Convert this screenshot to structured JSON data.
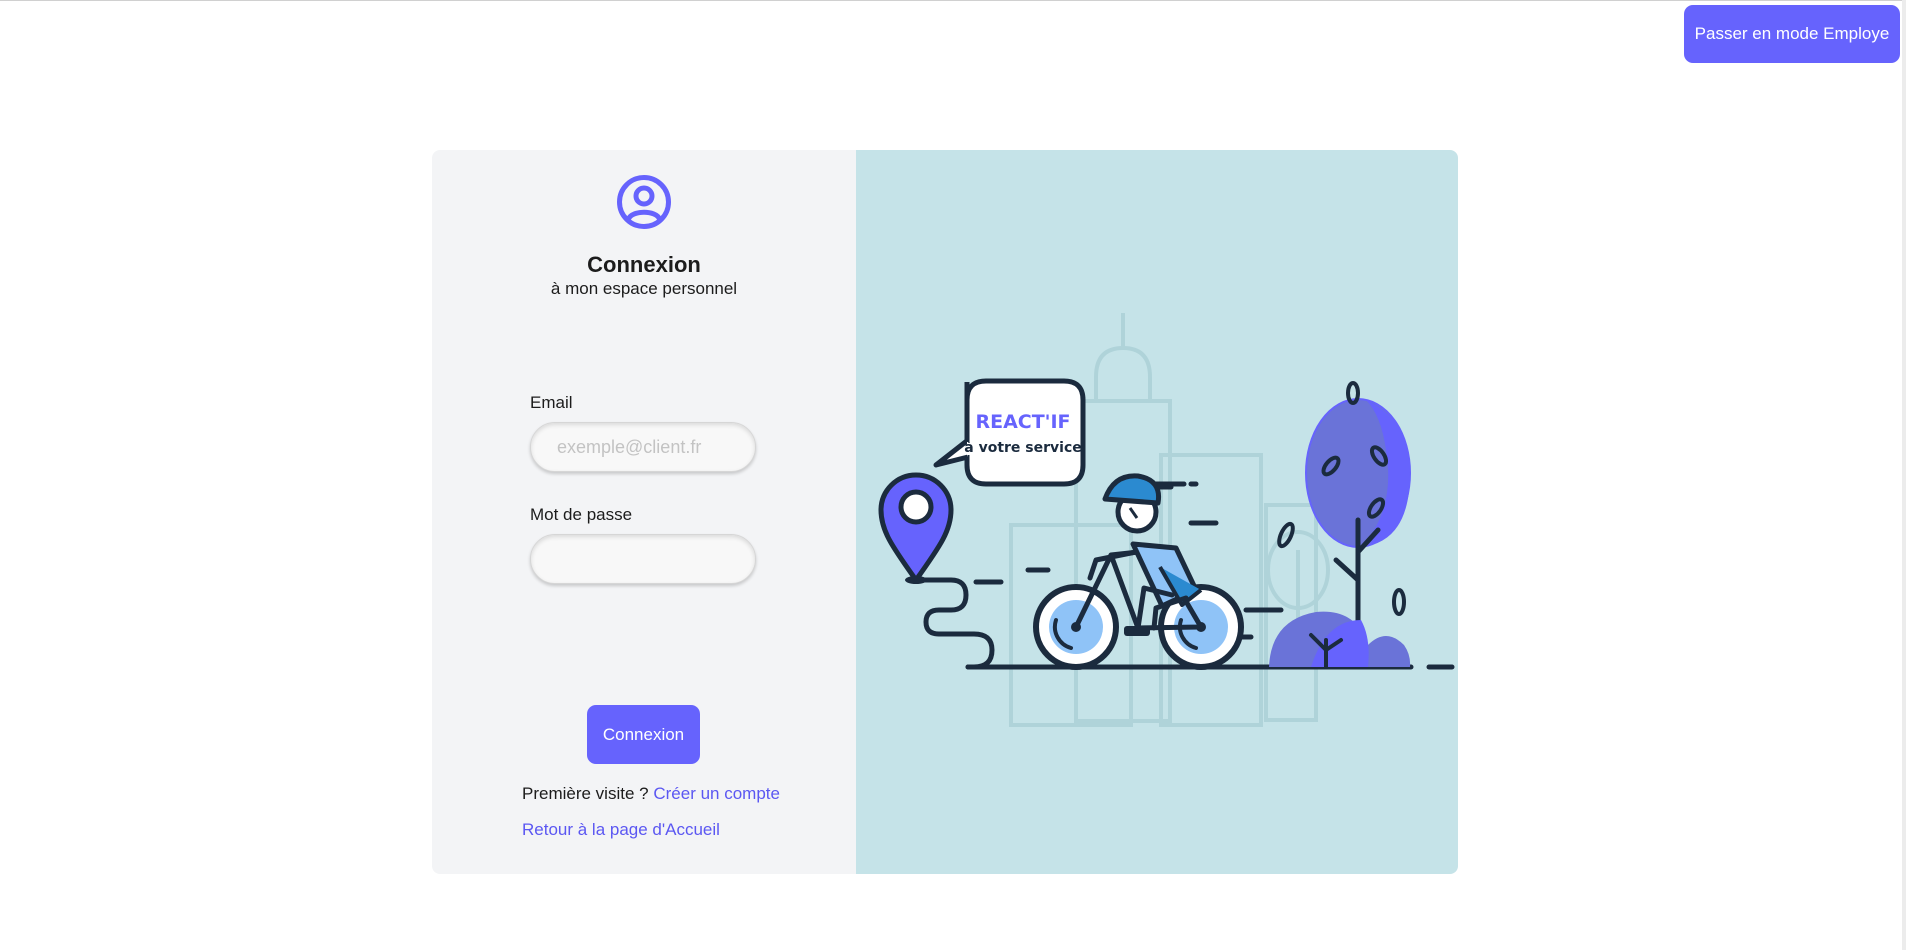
{
  "header": {
    "mode_button_label": "Passer en mode Employe"
  },
  "login": {
    "title": "Connexion",
    "subtitle": "à mon espace personnel",
    "email_label": "Email",
    "email_placeholder": "exemple@client.fr",
    "email_value": "",
    "password_label": "Mot de passe",
    "password_value": "",
    "submit_label": "Connexion",
    "first_visit_text": "Première visite ?",
    "create_account_link": "Créer un compte",
    "home_link": "Retour à la page d'Accueil"
  },
  "illustration": {
    "brand": "REACT'IF",
    "tagline": "à votre service"
  },
  "icons": {
    "user": "user-circle-icon",
    "location": "map-pin-icon"
  },
  "colors": {
    "accent": "#6663fd",
    "link": "#5b57f2",
    "left_panel_bg": "#f3f4f6",
    "right_panel_bg": "#c5e3e8",
    "ink": "#1b2b3e"
  }
}
